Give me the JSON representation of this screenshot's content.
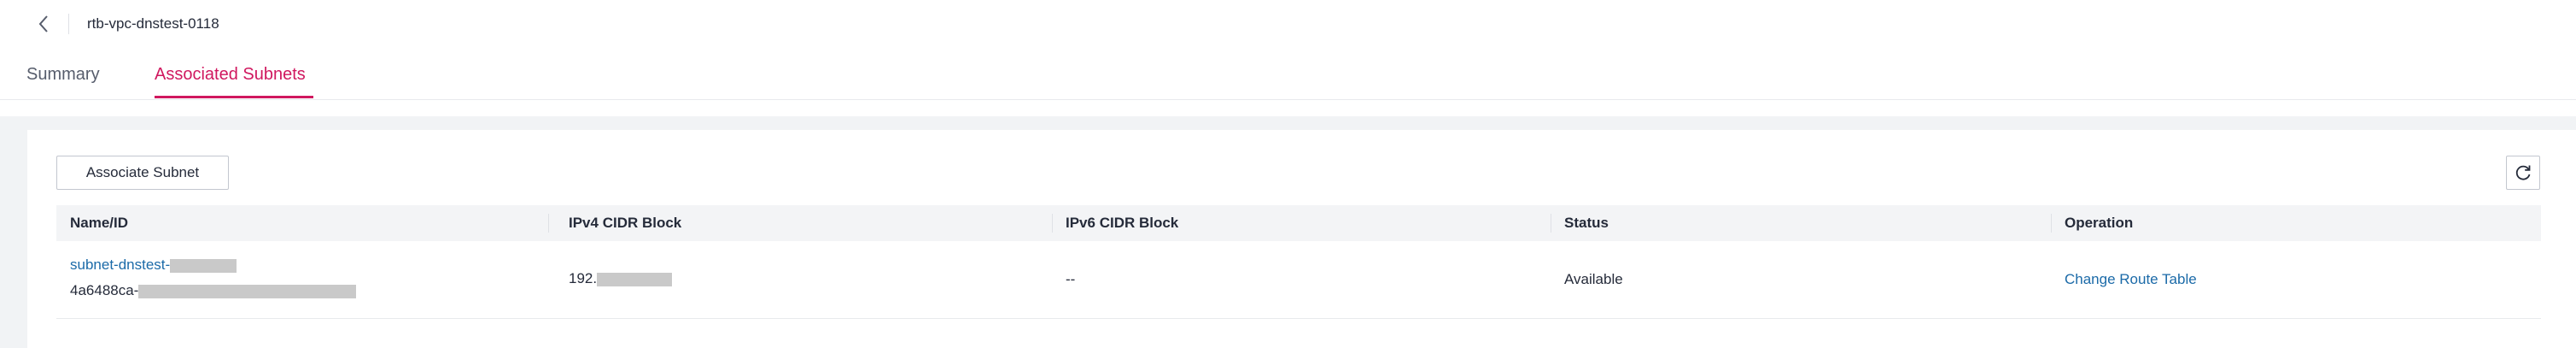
{
  "header": {
    "title": "rtb-vpc-dnstest-0118",
    "back_icon": "chevron-left-icon"
  },
  "tabs": [
    {
      "label": "Summary",
      "active": false
    },
    {
      "label": "Associated Subnets",
      "active": true
    }
  ],
  "colors": {
    "accent": "#d0185f",
    "link": "#1b6aa8",
    "content_background": "#f1f3f5",
    "table_header_background": "#f3f4f6"
  },
  "toolbar": {
    "associate_label": "Associate Subnet",
    "refresh_icon": "refresh-icon"
  },
  "table": {
    "columns": [
      "Name/ID",
      "IPv4 CIDR Block",
      "IPv6 CIDR Block",
      "Status",
      "Operation"
    ],
    "rows": [
      {
        "name": "subnet-dnstest-",
        "id": "4a6488ca-",
        "ipv4": "192.",
        "ipv6": "--",
        "status": "Available",
        "operation": "Change Route Table"
      }
    ]
  }
}
